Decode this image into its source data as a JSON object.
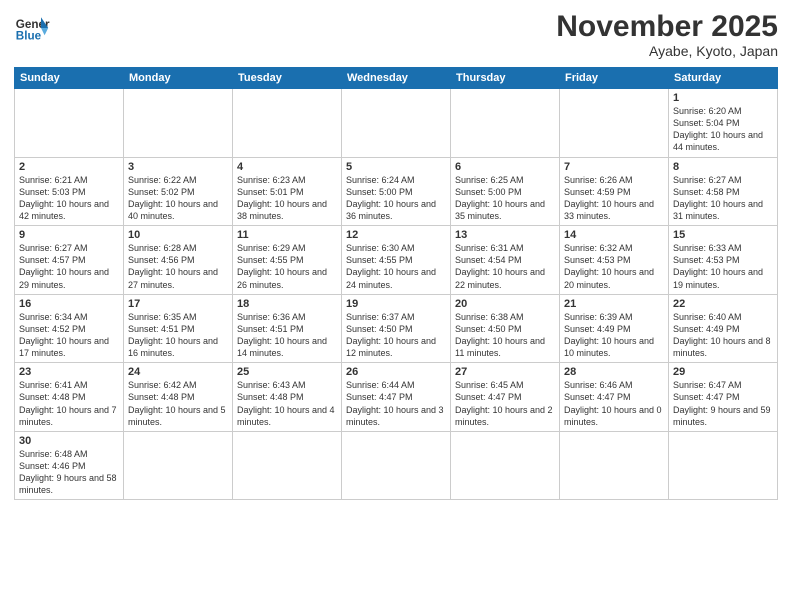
{
  "header": {
    "logo_general": "General",
    "logo_blue": "Blue",
    "month_title": "November 2025",
    "location": "Ayabe, Kyoto, Japan"
  },
  "weekdays": [
    "Sunday",
    "Monday",
    "Tuesday",
    "Wednesday",
    "Thursday",
    "Friday",
    "Saturday"
  ],
  "weeks": [
    [
      {
        "day": "",
        "info": "",
        "empty": true
      },
      {
        "day": "",
        "info": "",
        "empty": true
      },
      {
        "day": "",
        "info": "",
        "empty": true
      },
      {
        "day": "",
        "info": "",
        "empty": true
      },
      {
        "day": "",
        "info": "",
        "empty": true
      },
      {
        "day": "",
        "info": "",
        "empty": true
      },
      {
        "day": "1",
        "info": "Sunrise: 6:20 AM\nSunset: 5:04 PM\nDaylight: 10 hours\nand 44 minutes.",
        "empty": false
      }
    ],
    [
      {
        "day": "2",
        "info": "Sunrise: 6:21 AM\nSunset: 5:03 PM\nDaylight: 10 hours\nand 42 minutes.",
        "empty": false
      },
      {
        "day": "3",
        "info": "Sunrise: 6:22 AM\nSunset: 5:02 PM\nDaylight: 10 hours\nand 40 minutes.",
        "empty": false
      },
      {
        "day": "4",
        "info": "Sunrise: 6:23 AM\nSunset: 5:01 PM\nDaylight: 10 hours\nand 38 minutes.",
        "empty": false
      },
      {
        "day": "5",
        "info": "Sunrise: 6:24 AM\nSunset: 5:00 PM\nDaylight: 10 hours\nand 36 minutes.",
        "empty": false
      },
      {
        "day": "6",
        "info": "Sunrise: 6:25 AM\nSunset: 5:00 PM\nDaylight: 10 hours\nand 35 minutes.",
        "empty": false
      },
      {
        "day": "7",
        "info": "Sunrise: 6:26 AM\nSunset: 4:59 PM\nDaylight: 10 hours\nand 33 minutes.",
        "empty": false
      },
      {
        "day": "8",
        "info": "Sunrise: 6:27 AM\nSunset: 4:58 PM\nDaylight: 10 hours\nand 31 minutes.",
        "empty": false
      }
    ],
    [
      {
        "day": "9",
        "info": "Sunrise: 6:27 AM\nSunset: 4:57 PM\nDaylight: 10 hours\nand 29 minutes.",
        "empty": false
      },
      {
        "day": "10",
        "info": "Sunrise: 6:28 AM\nSunset: 4:56 PM\nDaylight: 10 hours\nand 27 minutes.",
        "empty": false
      },
      {
        "day": "11",
        "info": "Sunrise: 6:29 AM\nSunset: 4:55 PM\nDaylight: 10 hours\nand 26 minutes.",
        "empty": false
      },
      {
        "day": "12",
        "info": "Sunrise: 6:30 AM\nSunset: 4:55 PM\nDaylight: 10 hours\nand 24 minutes.",
        "empty": false
      },
      {
        "day": "13",
        "info": "Sunrise: 6:31 AM\nSunset: 4:54 PM\nDaylight: 10 hours\nand 22 minutes.",
        "empty": false
      },
      {
        "day": "14",
        "info": "Sunrise: 6:32 AM\nSunset: 4:53 PM\nDaylight: 10 hours\nand 20 minutes.",
        "empty": false
      },
      {
        "day": "15",
        "info": "Sunrise: 6:33 AM\nSunset: 4:53 PM\nDaylight: 10 hours\nand 19 minutes.",
        "empty": false
      }
    ],
    [
      {
        "day": "16",
        "info": "Sunrise: 6:34 AM\nSunset: 4:52 PM\nDaylight: 10 hours\nand 17 minutes.",
        "empty": false
      },
      {
        "day": "17",
        "info": "Sunrise: 6:35 AM\nSunset: 4:51 PM\nDaylight: 10 hours\nand 16 minutes.",
        "empty": false
      },
      {
        "day": "18",
        "info": "Sunrise: 6:36 AM\nSunset: 4:51 PM\nDaylight: 10 hours\nand 14 minutes.",
        "empty": false
      },
      {
        "day": "19",
        "info": "Sunrise: 6:37 AM\nSunset: 4:50 PM\nDaylight: 10 hours\nand 12 minutes.",
        "empty": false
      },
      {
        "day": "20",
        "info": "Sunrise: 6:38 AM\nSunset: 4:50 PM\nDaylight: 10 hours\nand 11 minutes.",
        "empty": false
      },
      {
        "day": "21",
        "info": "Sunrise: 6:39 AM\nSunset: 4:49 PM\nDaylight: 10 hours\nand 10 minutes.",
        "empty": false
      },
      {
        "day": "22",
        "info": "Sunrise: 6:40 AM\nSunset: 4:49 PM\nDaylight: 10 hours\nand 8 minutes.",
        "empty": false
      }
    ],
    [
      {
        "day": "23",
        "info": "Sunrise: 6:41 AM\nSunset: 4:48 PM\nDaylight: 10 hours\nand 7 minutes.",
        "empty": false
      },
      {
        "day": "24",
        "info": "Sunrise: 6:42 AM\nSunset: 4:48 PM\nDaylight: 10 hours\nand 5 minutes.",
        "empty": false
      },
      {
        "day": "25",
        "info": "Sunrise: 6:43 AM\nSunset: 4:48 PM\nDaylight: 10 hours\nand 4 minutes.",
        "empty": false
      },
      {
        "day": "26",
        "info": "Sunrise: 6:44 AM\nSunset: 4:47 PM\nDaylight: 10 hours\nand 3 minutes.",
        "empty": false
      },
      {
        "day": "27",
        "info": "Sunrise: 6:45 AM\nSunset: 4:47 PM\nDaylight: 10 hours\nand 2 minutes.",
        "empty": false
      },
      {
        "day": "28",
        "info": "Sunrise: 6:46 AM\nSunset: 4:47 PM\nDaylight: 10 hours\nand 0 minutes.",
        "empty": false
      },
      {
        "day": "29",
        "info": "Sunrise: 6:47 AM\nSunset: 4:47 PM\nDaylight: 9 hours\nand 59 minutes.",
        "empty": false
      }
    ],
    [
      {
        "day": "30",
        "info": "Sunrise: 6:48 AM\nSunset: 4:46 PM\nDaylight: 9 hours\nand 58 minutes.",
        "empty": false
      },
      {
        "day": "",
        "info": "",
        "empty": true
      },
      {
        "day": "",
        "info": "",
        "empty": true
      },
      {
        "day": "",
        "info": "",
        "empty": true
      },
      {
        "day": "",
        "info": "",
        "empty": true
      },
      {
        "day": "",
        "info": "",
        "empty": true
      },
      {
        "day": "",
        "info": "",
        "empty": true
      }
    ]
  ]
}
